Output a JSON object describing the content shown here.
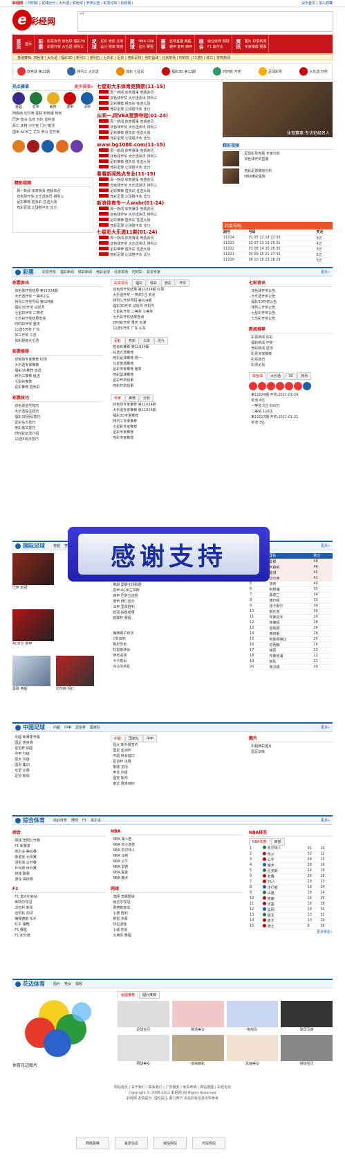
{
  "topbar": {
    "left": "彩经网",
    "links": "| 时时彩 | 足球比分 | 大乐透 | 双色球 | 开奖公告 | 彩票论坛 | 彩经网 |",
    "right": "设为首页 | 加入收藏"
  },
  "logo": {
    "mark": "e",
    "text": "彩经网"
  },
  "banner_alt": "ad",
  "nav": [
    {
      "big": "首页",
      "cols": [
        "首页"
      ]
    },
    {
      "big": "彩票",
      "cols": [
        "彩票资讯 双色球 福彩3D",
        "彩票开奖 大乐透 排列三"
      ]
    },
    {
      "big": "足球",
      "cols": [
        "足彩 竞彩 北单",
        "比分 赔率 阵容"
      ]
    },
    {
      "big": "篮球",
      "cols": [
        "NBA CBA",
        "比分 赛程"
      ]
    },
    {
      "big": "赛事",
      "cols": [
        "足球直播 英超",
        "德甲 意甲 西甲"
      ]
    },
    {
      "big": "综合",
      "cols": [
        "综合体育 网球",
        "F1 高尔夫"
      ]
    },
    {
      "big": "资讯",
      "cols": [
        "图片 彩票新闻",
        "专家推荐 赛事"
      ]
    }
  ],
  "subnav": "重磅推荐: 双色球 | 大乐透 | 福彩3D | 排列三 | 排列五 | 七乐彩 | 足彩 | 竞彩足球 | 竞彩篮球 | 北京单场 | 时时彩 | 11选5 | 快三 | 体育新闻",
  "lottbar": [
    "双色球 第11期",
    "排列三 大乐透",
    "体彩 七星彩",
    "福彩3D 第11期",
    "时时彩 开奖",
    "足球彩票",
    "大乐透 开奖"
  ],
  "hot": {
    "title": "热点赛事",
    "more": "更多赛事»",
    "clubs": [
      "英超",
      "意甲",
      "西甲",
      "德甲",
      "法甲"
    ],
    "rows": [
      "阿森纳 切尔西 曼联 利物浦 热刺",
      "巴萨 皇马 马竞 瓦伦 比利亚",
      "拜仁 多特 沙尔克 门兴 勒沃",
      "国米 AC米兰 尤文 罗马 拉齐奥"
    ]
  },
  "news_heads": [
    "七星彩大乐体育竞猜票(11-15)",
    "从同一,同VEA竞猜夺冠(01-24)",
    "www.bg1088.com(11-15)",
    "看看新闻热点专业(11-15)",
    "新浪体育专一人wxbr(01-24)",
    "七星彩大乐透11期(01-24)"
  ],
  "news_items": [
    "周一新闻 体育赛事 竞猜资讯",
    "双色球开奖 大乐透资讯 排列三",
    "足彩推荐 胜负彩 任选九场",
    "竞彩足球 让球胜平负 比分"
  ],
  "feature": {
    "caption": "体育赛事:专访彩经名人"
  },
  "video": {
    "title": "精彩视频",
    "items": [
      "足球彩票竞猜 专家分析",
      "双色球开奖直播",
      "竞彩足球赛前分析",
      "NBA精彩集锦"
    ]
  },
  "ranking": {
    "title": "开奖号码",
    "cols": [
      "期号",
      "号码",
      "奖池"
    ],
    "rows": [
      [
        "11024",
        "01 05 12 18 22 33",
        "5亿"
      ],
      [
        "11023",
        "02 07 13 19 25 31",
        "4亿"
      ],
      [
        "11022",
        "03 08 14 20 26 30",
        "3亿"
      ],
      [
        "11021",
        "04 09 15 21 27 32",
        "2亿"
      ],
      [
        "11020",
        "06 10 16 23 28 29",
        "1亿"
      ]
    ]
  },
  "lottery": {
    "title": "彩票",
    "links": [
      "彩票开奖",
      "福彩新闻",
      "体彩新闻",
      "竞彩足球",
      "北京单场",
      "时时彩",
      "彩票专家"
    ],
    "more": "更多»",
    "col1": {
      "h": "彩票资讯",
      "items": [
        "双色球开奖结果 第11024期",
        "大乐透开奖 一等奖2注",
        "排列三开奖号码 第024期",
        "福彩3D开奖 试机号",
        "七星彩开奖 二等奖",
        "七乐彩开奖结果查询",
        "时时彩开奖 重庆",
        "11选5开奖 广东",
        "快三开奖 江苏",
        "体彩超级大乐透"
      ]
    },
    "col1b": {
      "h": "彩票推荐",
      "items": [
        "双色球专家推荐 红球",
        "大乐透专家推荐",
        "福彩3D推荐 直选",
        "排列三推荐 组选",
        "七星彩推荐",
        "足彩推荐 胜负彩"
      ]
    },
    "col1c": {
      "h": "彩票技巧",
      "items": [
        "双色球选号技巧",
        "大乐透投注技巧",
        "福彩3D胆码技巧",
        "足彩任九技巧",
        "竞彩串关技巧",
        "时时彩玩法介绍",
        "11选5玩法技巧"
      ]
    },
    "tabs1": [
      "彩票资讯",
      "福彩",
      "体彩",
      "竞彩",
      "开奖"
    ],
    "tabs1_more": "更多»",
    "mid1": [
      "双色球开奖结果 第11024期 红球",
      "大乐透开奖 一等奖2注 奖池",
      "排列三开奖号码 第024期",
      "福彩3D开奖 试机号 开机号",
      "七星彩开奖 二等奖 三等奖",
      "七乐彩开奖结果查询",
      "时时彩开奖 重庆 天津",
      "11选5开奖 广东 山东"
    ],
    "tabs2": [
      "足彩",
      "竞彩",
      "北单",
      "任九"
    ],
    "mid2": [
      "胜负彩推荐 第11024期",
      "任选九场推荐",
      "竞彩足球推荐 周一",
      "北京单场推荐",
      "足彩专家推荐 赔率",
      "竞彩篮球推荐",
      "足彩开奖结果",
      "竞彩开奖结果"
    ],
    "tabs3": [
      "专家",
      "推荐",
      "分析"
    ],
    "mid3": [
      "双色球专家推荐 第11024期",
      "大乐透专家推荐 第11024期",
      "福彩3D专家推荐",
      "排列三专家推荐",
      "七星彩专家推荐",
      "足彩专家推荐",
      "竞彩专家推荐"
    ],
    "right1": {
      "h": "七彩资讯",
      "items": [
        "双色球开奖公告",
        "大乐透开奖公告",
        "福彩3D开奖公告",
        "排列三开奖公告",
        "七星彩开奖公告",
        "七乐彩开奖公告"
      ]
    },
    "right2": {
      "h": "新闻推荐",
      "items": [
        "彩票新闻 体彩",
        "福彩新闻 中奖",
        "竞彩新闻 足球",
        "彩票专家推荐",
        "彩票技巧",
        "彩票论坛"
      ]
    },
    "kj_tabs": [
      "双色球",
      "大乐透",
      "3D",
      "排列"
    ],
    "kj_rows": [
      "第11024期 开奖:2011-01-24",
      "奖池:4亿",
      "一等奖:5注 500万",
      "二等奖:120注",
      "第11023期 开奖:2011-01-21",
      "奖池:3亿"
    ]
  },
  "intl": {
    "title": "国际足球",
    "links": [
      "英超",
      "意甲",
      "西甲",
      "德甲",
      "法甲"
    ],
    "more": "更多»",
    "cap1": "巴萨 欧冠",
    "cap2": "AC米兰 意甲",
    "cap3": "曼联 英超",
    "cap4": "切尔西 拜仁",
    "mid": [
      "英超 曼联主场取胜",
      "意甲 AC米兰领跑",
      "西甲 巴萨五连胜",
      "德甲 拜仁追分",
      "法甲 里昂胜利",
      "欧冠 抽签结果",
      "欧联杯 赛程"
    ],
    "mid2": [
      "梅西帽子戏法",
      "C罗双响",
      "鲁尼伤愈",
      "托雷斯转会",
      "伊布进球",
      "卡卡复出",
      "内马尔新星"
    ],
    "table": {
      "cols": [
        "排名",
        "球队",
        "积分"
      ],
      "rows": [
        [
          "1",
          "曼联",
          "48"
        ],
        [
          "2",
          "阿森纳",
          "46"
        ],
        [
          "3",
          "曼城",
          "45"
        ],
        [
          "4",
          "切尔西",
          "41"
        ],
        [
          "5",
          "热刺",
          "40"
        ],
        [
          "6",
          "利物浦",
          "35"
        ],
        [
          "7",
          "桑德兰",
          "34"
        ],
        [
          "8",
          "博尔顿",
          "33"
        ],
        [
          "9",
          "纽卡斯尔",
          "30"
        ],
        [
          "10",
          "斯托克",
          "30"
        ],
        [
          "11",
          "布莱克本",
          "29"
        ],
        [
          "12",
          "埃弗顿",
          "28"
        ],
        [
          "13",
          "富勒姆",
          "26"
        ],
        [
          "14",
          "西布朗",
          "26"
        ],
        [
          "15",
          "阿斯顿维拉",
          "25"
        ],
        [
          "16",
          "伯明翰",
          "24"
        ],
        [
          "17",
          "维冈",
          "23"
        ],
        [
          "18",
          "布莱克浦",
          "22"
        ],
        [
          "19",
          "狼队",
          "21"
        ],
        [
          "20",
          "西汉姆",
          "20"
        ]
      ]
    }
  },
  "cn": {
    "title": "中国足球",
    "links": [
      "中超",
      "中甲",
      "足协杯",
      "国家队"
    ],
    "more": "更多»",
    "left": [
      "中超 新赛季开幕",
      "国足 热身赛",
      "足协杯 抽签",
      "中甲 升级",
      "恒大 引援",
      "国青 集训",
      "女足 比赛",
      "足协 新规"
    ],
    "tabs": [
      "中超",
      "国家队",
      "中甲"
    ],
    "mid": [
      "恒大 新外援签约",
      "国足 亚洲杯",
      "中超 转会窗口",
      "足协杯 决赛",
      "鲁能 主场",
      "申花 外援",
      "国安 新帅",
      "泰达 赛季目标"
    ],
    "right": {
      "h": "图片",
      "items": [
        "中超精彩图片",
        "国足训练"
      ]
    }
  },
  "multi": {
    "title": "综合体育",
    "links": [
      "综合体育",
      "网球",
      "F1",
      "高尔夫"
    ],
    "more": "更多»",
    "left1": {
      "h": "综合",
      "items": [
        "网球 澳网公开赛",
        "F1 新赛季",
        "高尔夫 美巡赛",
        "斯诺克 大师赛",
        "羽毛球 公开赛",
        "乒乓球 世乒赛",
        "排球 联赛",
        "游泳 锦标赛"
      ]
    },
    "left2": {
      "h": "F1",
      "items": [
        "F1 澳大利亚站",
        "维特尔夺冠",
        "法拉利 新车",
        "迈凯轮 测试",
        "梅赛德斯 车手",
        "红牛 策略",
        "F1 赛程",
        "F1 积分榜"
      ]
    },
    "mid1": {
      "h": "NBA",
      "items": [
        "NBA 湖人胜",
        "NBA 热火连胜",
        "NBA 凯尔特人",
        "NBA 马刺",
        "NBA 公牛",
        "NBA 雷霆",
        "NBA 掘金",
        "NBA 魔术"
      ]
    },
    "mid2": {
      "h": "网球",
      "items": [
        "澳网 李娜晋级",
        "纳达尔夺冠",
        "费德勒复出",
        "小德 胜利",
        "穆雷 决赛",
        "莎拉波娃",
        "小威 伤愈",
        "大满贯 赛程"
      ]
    },
    "nba": {
      "h": "NBA排名",
      "tabs": [
        "NBA东部",
        "西部"
      ],
      "rows": [
        [
          "1",
          "凯尔特人",
          "31",
          "10"
        ],
        [
          "2",
          "热火",
          "32",
          "12"
        ],
        [
          "3",
          "公牛",
          "29",
          "13"
        ],
        [
          "4",
          "魔术",
          "28",
          "16"
        ],
        [
          "5",
          "尼克斯",
          "24",
          "19"
        ],
        [
          "6",
          "老鹰",
          "26",
          "18"
        ],
        [
          "7",
          "76人",
          "20",
          "23"
        ],
        [
          "8",
          "步行者",
          "18",
          "24"
        ],
        [
          "9",
          "山猫",
          "18",
          "24"
        ],
        [
          "10",
          "雄鹿",
          "16",
          "26"
        ],
        [
          "11",
          "活塞",
          "16",
          "28"
        ],
        [
          "12",
          "篮网",
          "13",
          "31"
        ],
        [
          "13",
          "猛龙",
          "13",
          "32"
        ],
        [
          "14",
          "奇才",
          "13",
          "29"
        ],
        [
          "15",
          "骑士",
          "8",
          "36"
        ]
      ],
      "more": "更多排名»"
    }
  },
  "photo": {
    "title": "花边体育",
    "links": [
      "图片",
      "美女",
      "视频"
    ],
    "tabs": [
      "组图推荐",
      "图片推荐"
    ],
    "caps": [
      "足球宝贝",
      "赛场美女",
      "啦啦队",
      "球员写真",
      "网球美女",
      "体操精彩",
      "泳装美女",
      "排球宝贝"
    ],
    "big_caption": "体育花边图片"
  },
  "footer": {
    "line1": "网站首页 | 关于我们 | 联系我们 | 广告服务 | 免责声明 | 网站地图 | 彩经论坛",
    "line2": "Copyright © 2008-2011 彩经网 All Rights Reserved",
    "line3": "彩经网 友情提示: 理性投注 量力而行 本站所有信息仅供参考",
    "badges": [
      "网络警察",
      "备案信息",
      "诚信网站",
      "可信网站"
    ]
  },
  "overlay_text": "感谢支持"
}
